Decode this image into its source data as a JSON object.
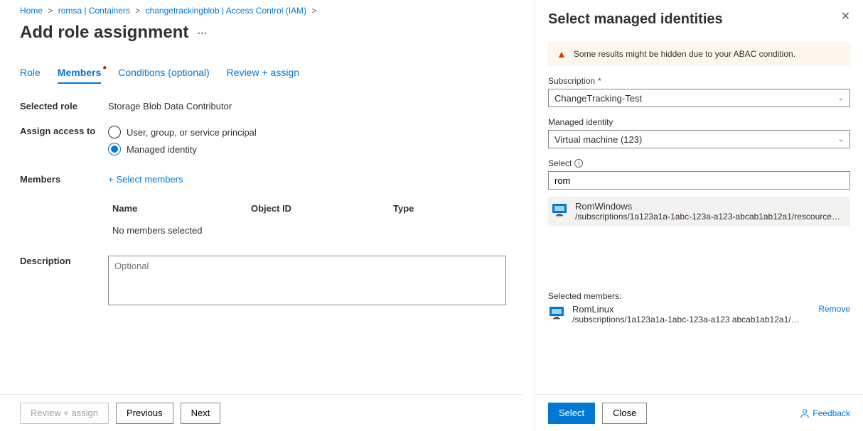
{
  "breadcrumb": {
    "items": [
      {
        "label": "Home"
      },
      {
        "label": "romsa | Containers"
      },
      {
        "label": "changetrackingblob | Access Control (IAM)"
      }
    ]
  },
  "page": {
    "title": "Add role assignment"
  },
  "tabs": {
    "items": [
      {
        "label": "Role"
      },
      {
        "label": "Members"
      },
      {
        "label": "Conditions (optional)"
      },
      {
        "label": "Review + assign"
      }
    ]
  },
  "form": {
    "selectedRoleLabel": "Selected role",
    "selectedRoleValue": "Storage Blob Data Contributor",
    "assignAccessLabel": "Assign access to",
    "radioUserGroup": "User, group, or service principal",
    "radioManagedIdentity": "Managed identity",
    "membersLabel": "Members",
    "selectMembersLink": "Select members",
    "tableHead": {
      "name": "Name",
      "objectId": "Object ID",
      "type": "Type"
    },
    "noMembers": "No members selected",
    "descriptionLabel": "Description",
    "descriptionPlaceholder": "Optional"
  },
  "footer": {
    "reviewAssign": "Review + assign",
    "previous": "Previous",
    "next": "Next"
  },
  "panel": {
    "title": "Select managed identities",
    "warning": "Some results might be hidden due to your ABAC condition.",
    "subscriptionLabel": "Subscription",
    "subscriptionValue": "ChangeTracking-Test",
    "managedIdentityLabel": "Managed identity",
    "managedIdentityValue": "Virtual machine (123)",
    "selectLabel": "Select",
    "searchValue": "rom",
    "result": {
      "name": "RomWindows",
      "path": "/subscriptions/1a123a1a-1abc-123a-a123-abcab1ab12a1/rescourceGroups"
    },
    "selectedMembersLabel": "Selected members:",
    "selectedMember": {
      "name": "RomLinux",
      "path": "/subscriptions/1a123a1a-1abc-123a-a123 abcab1ab12a1/rescou.."
    },
    "removeLink": "Remove",
    "selectButton": "Select",
    "closeButton": "Close",
    "feedback": "Feedback"
  }
}
